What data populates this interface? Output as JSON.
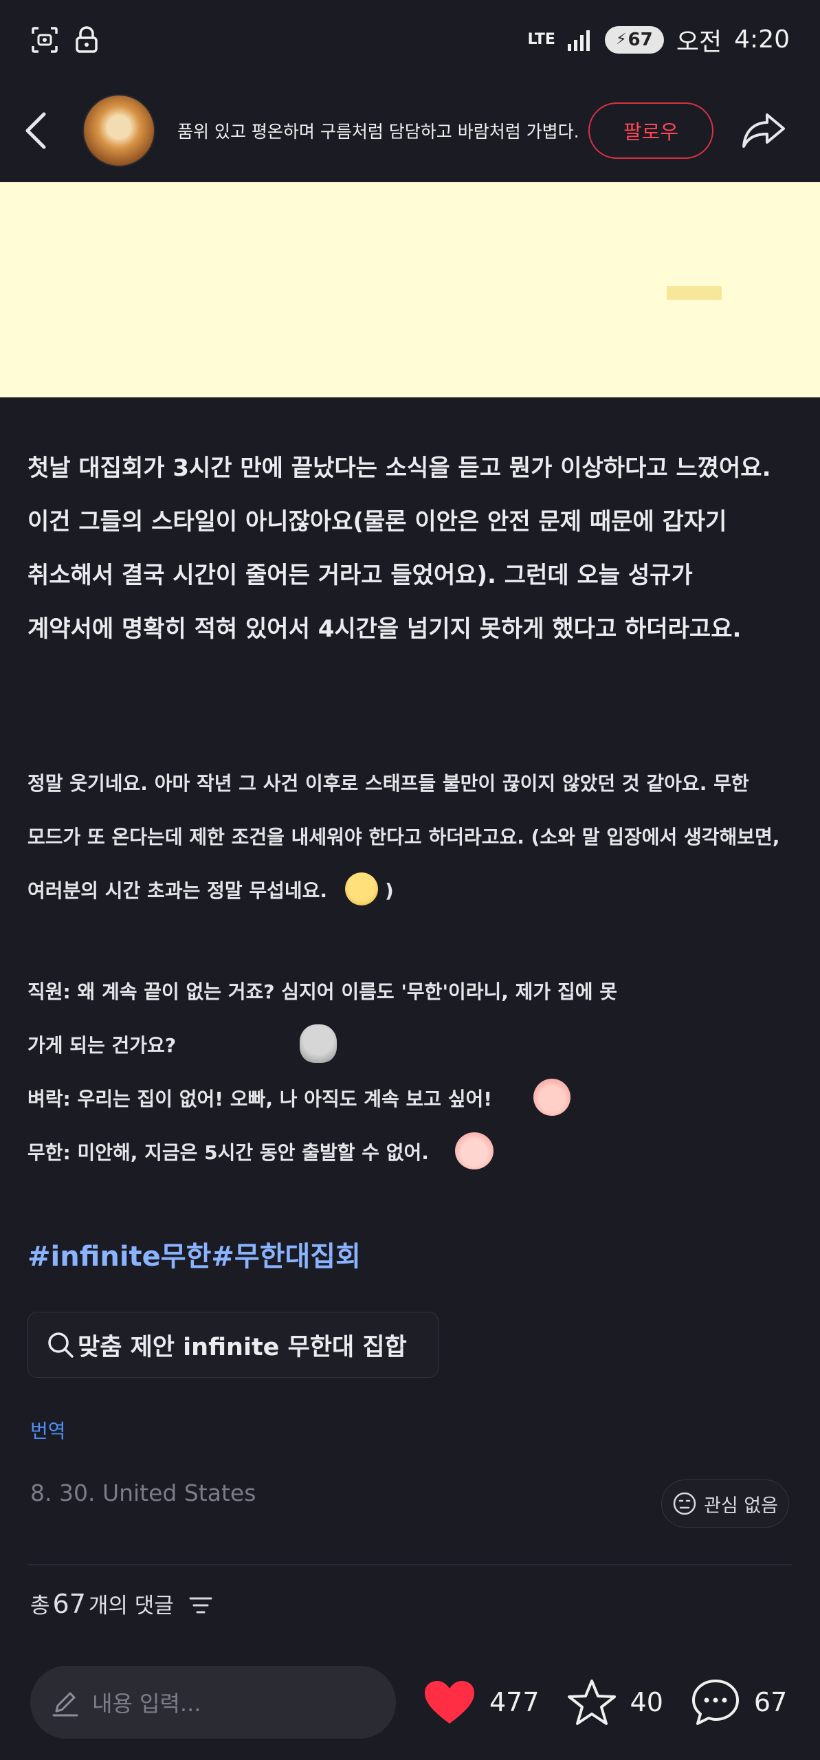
{
  "status_bar": {
    "network": "LTE",
    "battery": "67",
    "ampm": "오전",
    "time": "4:20"
  },
  "header": {
    "back_icon": "back-arrow-icon",
    "profile_text": "품위 있고 평온하며 구름처럼 담담하고 바람처럼 가볍다.",
    "follow_label": "팔로우",
    "share_icon": "share-icon"
  },
  "post": {
    "paragraph1": [
      "첫날 대집회가 3시간 만에 끝났다는 소식을 듣고 뭔가 이상하다고 느꼈어요.",
      "이건 그들의 스타일이 아니잖아요(물론 이안은 안전 문제 때문에 갑자기",
      "취소해서 결국 시간이 줄어든 거라고 들었어요). 그런데 오늘 성규가",
      "계약서에 명확히 적혀 있어서 4시간을 넘기지 못하게 했다고 하더라고요."
    ],
    "paragraph2": [
      "정말 웃기네요. 아마 작년 그 사건 이후로 스태프들 불만이 끊이지 않았던 것 같아요. 무한",
      "모드가 또 온다는데 제한 조건을 내세워야 한다고 하더라고요. (소와 말 입장에서 생각해보면,",
      "여러분의 시간 초과는 정말 무섭네요."
    ],
    "paragraph2_tail": ")",
    "dialogue": [
      "직원: 왜 계속 끝이 없는 거죠? 심지어 이름도 '무한'이라니, 제가 집에 못",
      "가게 되는 건가요?",
      "벼락: 우리는 집이 없어! 오빠, 나 아직도 계속 보고 싶어!",
      "무한: 미안해, 지금은 5시간 동안 출발할 수 없어."
    ],
    "hashtags": "#infinite무한#무한대집회",
    "search_chip": "맞춤 제안 infinite 무한대 집합",
    "translate": "번역",
    "meta": "8. 30. United States",
    "not_interested": "관심 없음"
  },
  "comments": {
    "prefix": "총",
    "count": "67",
    "suffix": "개의 댓글"
  },
  "bottom_bar": {
    "input_placeholder": "내용 입력...",
    "likes": "477",
    "stars": "40",
    "comments": "67",
    "like_color": "#ff2e45"
  }
}
